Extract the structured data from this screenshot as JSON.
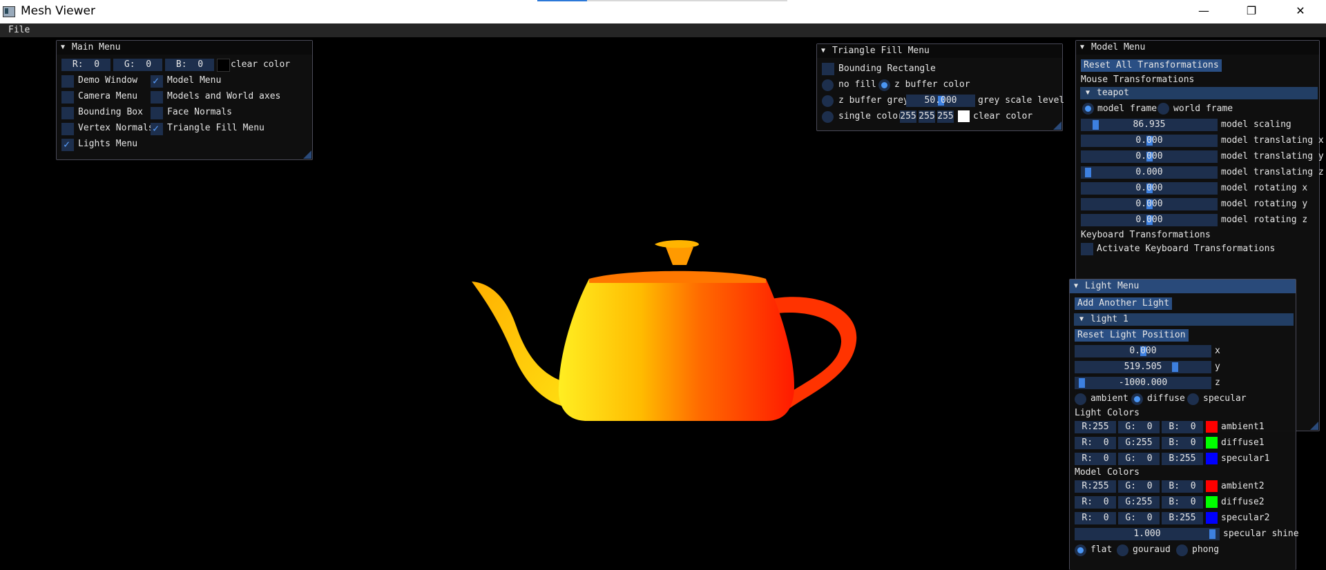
{
  "window": {
    "title": "Mesh Viewer",
    "minimize_glyph": "—",
    "maximize_glyph": "❐",
    "close_glyph": "✕"
  },
  "menubar": {
    "file": "File"
  },
  "main_menu": {
    "title": "Main Menu",
    "clear_color": {
      "r": "R:  0",
      "g": "G:  0",
      "b": "B:  0",
      "label": "clear color",
      "swatch": "#000000"
    },
    "items": [
      {
        "label": "Demo Window",
        "checked": false
      },
      {
        "label": "Model Menu",
        "checked": true
      },
      {
        "label": "Camera Menu",
        "checked": false
      },
      {
        "label": "Models and World axes",
        "checked": false
      },
      {
        "label": "Bounding Box",
        "checked": false
      },
      {
        "label": "Face Normals",
        "checked": false
      },
      {
        "label": "Vertex Normals",
        "checked": false
      },
      {
        "label": "Triangle Fill Menu",
        "checked": true
      },
      {
        "label": "Lights Menu",
        "checked": true
      }
    ]
  },
  "triangle_menu": {
    "title": "Triangle Fill Menu",
    "bounding_rect": "Bounding Rectangle",
    "no_fill": "no fill",
    "z_buffer_color": "z buffer color",
    "z_buffer_grey": "z buffer grey",
    "grey_value": "50.000",
    "grey_level": 0.5,
    "grey_label": "grey scale level",
    "single_color": "single color",
    "sc_r": "255",
    "sc_g": "255",
    "sc_b": "255",
    "sc_swatch": "#ffffff",
    "clear_color": "clear color"
  },
  "model_menu": {
    "title": "Model Menu",
    "reset_btn": "Reset All Transformations",
    "mouse_title": "Mouse Transformations",
    "model_name": "teapot",
    "model_frame": "model frame",
    "world_frame": "world frame",
    "sliders": [
      {
        "value": "86.935",
        "label": "model scaling",
        "pos": 0.08
      },
      {
        "value": "0.000",
        "label": "model translating x",
        "pos": 0.5
      },
      {
        "value": "0.000",
        "label": "model translating y",
        "pos": 0.5
      },
      {
        "value": "0.000",
        "label": "model translating z",
        "pos": 0.02
      },
      {
        "value": "0.000",
        "label": "model rotating x",
        "pos": 0.5
      },
      {
        "value": "0.000",
        "label": "model rotating y",
        "pos": 0.5
      },
      {
        "value": "0.000",
        "label": "model rotating z",
        "pos": 0.5
      }
    ],
    "keyboard_title": "Keyboard Transformations",
    "keyboard_cb": "Activate Keyboard Transformations"
  },
  "light_menu": {
    "title": "Light Menu",
    "add_btn": "Add Another Light",
    "light_name": "light 1",
    "reset_pos": "Reset Light Position",
    "pos": [
      {
        "value": "0.000",
        "axis": "x",
        "pos": 0.5
      },
      {
        "value": "519.505",
        "axis": "y",
        "pos": 0.75
      },
      {
        "value": "-1000.000",
        "axis": "z",
        "pos": 0.02
      }
    ],
    "modes": [
      "ambient",
      "diffuse",
      "specular"
    ],
    "light_colors_title": "Light Colors",
    "light_colors": [
      {
        "r": "R:255",
        "g": "G:  0",
        "b": "B:  0",
        "label": "ambient1",
        "swatch": "#ff0000"
      },
      {
        "r": "R:  0",
        "g": "G:255",
        "b": "B:  0",
        "label": "diffuse1",
        "swatch": "#00ff00"
      },
      {
        "r": "R:  0",
        "g": "G:  0",
        "b": "B:255",
        "label": "specular1",
        "swatch": "#0000ff"
      }
    ],
    "model_colors_title": "Model Colors",
    "model_colors": [
      {
        "r": "R:255",
        "g": "G:  0",
        "b": "B:  0",
        "label": "ambient2",
        "swatch": "#ff0000"
      },
      {
        "r": "R:  0",
        "g": "G:255",
        "b": "B:  0",
        "label": "diffuse2",
        "swatch": "#00ff00"
      },
      {
        "r": "R:  0",
        "g": "G:  0",
        "b": "B:255",
        "label": "specular2",
        "swatch": "#0000ff"
      }
    ],
    "shine_value": "1.000",
    "shine_pos": 0.98,
    "shine_label": "specular shine",
    "shading": [
      "flat",
      "gouraud",
      "phong"
    ]
  }
}
